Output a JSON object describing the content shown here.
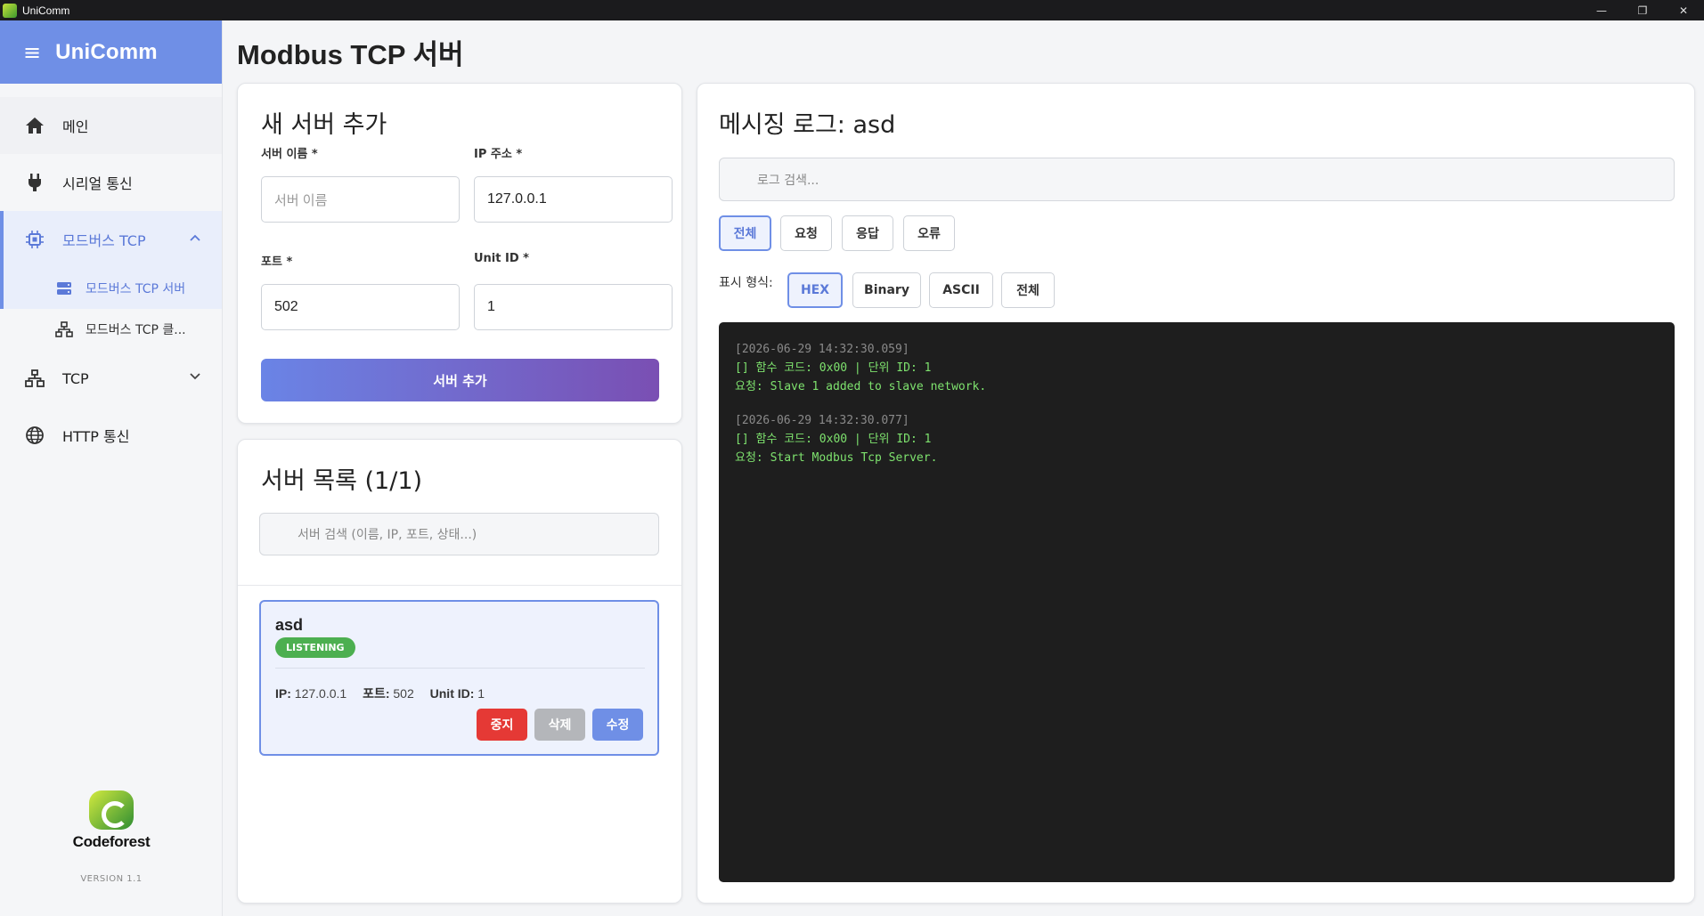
{
  "window": {
    "title": "UniComm",
    "min": "—",
    "max": "❐",
    "close": "✕"
  },
  "sidebar": {
    "brand": "UniComm",
    "items": [
      {
        "label": "메인",
        "icon": "home-icon"
      },
      {
        "label": "시리얼 통신",
        "icon": "plug-icon"
      },
      {
        "label": "모드버스 TCP",
        "icon": "chip-icon",
        "expanded": true
      },
      {
        "label": "TCP",
        "icon": "network-icon"
      },
      {
        "label": "HTTP 통신",
        "icon": "globe-icon"
      }
    ],
    "subitems": [
      {
        "label": "모드버스 TCP 서버",
        "icon": "server-icon"
      },
      {
        "label": "모드버스 TCP 클...",
        "icon": "network-icon"
      }
    ],
    "logo_text": "Codeforest",
    "version": "VERSION 1.1"
  },
  "page": {
    "title": "Modbus TCP 서버"
  },
  "add_server": {
    "title": "새 서버 추가",
    "name_label": "서버 이름 *",
    "name_placeholder": "서버 이름",
    "ip_label": "IP 주소 *",
    "ip_value": "127.0.0.1",
    "port_label": "포트 *",
    "port_value": "502",
    "unit_label": "Unit ID *",
    "unit_value": "1",
    "submit": "서버 추가"
  },
  "server_list": {
    "title": "서버 목록 (1/1)",
    "search_placeholder": "서버 검색 (이름, IP, 포트, 상태...)",
    "servers": [
      {
        "name": "asd",
        "status": "LISTENING",
        "ip_label": "IP:",
        "ip": "127.0.0.1",
        "port_label": "포트:",
        "port": "502",
        "unit_label": "Unit ID:",
        "unit": "1",
        "stop": "중지",
        "delete": "삭제",
        "edit": "수정"
      }
    ]
  },
  "log": {
    "title": "메시징 로그: asd",
    "search_placeholder": "로그 검색...",
    "filters": [
      "전체",
      "요청",
      "응답",
      "오류"
    ],
    "format_label": "표시 형식:",
    "formats": [
      "HEX",
      "Binary",
      "ASCII",
      "전체"
    ],
    "entries": [
      {
        "time": "[2026-06-29 14:32:30.059]",
        "line1": "[] 함수 코드: 0x00 | 단위 ID: 1",
        "line2": "요청: Slave 1 added to slave network."
      },
      {
        "time": "[2026-06-29 14:32:30.077]",
        "line1": "[] 함수 코드: 0x00 | 단위 ID: 1",
        "line2": "요청: Start Modbus Tcp Server."
      }
    ]
  },
  "colors": {
    "accent": "#6f8fe6",
    "listening": "#4caf50",
    "stop": "#e53935",
    "terminal_text": "#7ee26e"
  }
}
